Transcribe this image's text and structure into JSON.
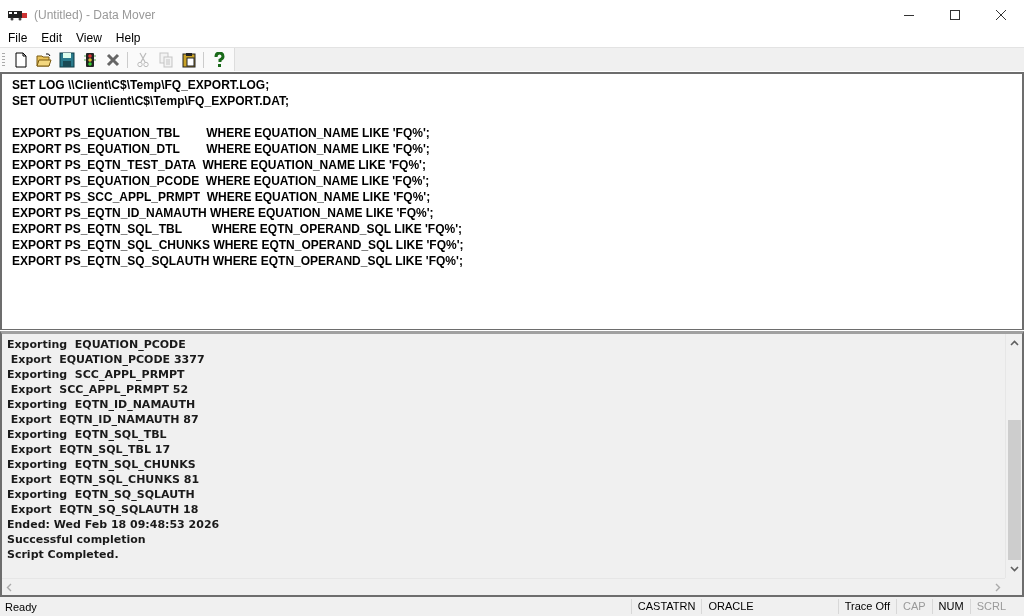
{
  "window": {
    "title": "(Untitled) - Data Mover"
  },
  "menu": [
    "File",
    "Edit",
    "View",
    "Help"
  ],
  "toolbar": [
    {
      "kind": "new",
      "disabled": false
    },
    {
      "kind": "open",
      "disabled": false
    },
    {
      "kind": "save",
      "disabled": false
    },
    {
      "kind": "run",
      "disabled": false
    },
    {
      "kind": "delete",
      "disabled": false
    },
    {
      "kind": "cut",
      "disabled": true
    },
    {
      "kind": "copy",
      "disabled": true
    },
    {
      "kind": "paste",
      "disabled": false
    },
    {
      "kind": "help",
      "disabled": false
    }
  ],
  "script_blocks": [
    [
      "SET LOG \\\\Client\\C$\\Temp\\FQ_EXPORT.LOG;",
      "SET OUTPUT \\\\Client\\C$\\Temp\\FQ_EXPORT.DAT;"
    ],
    [
      "EXPORT PS_EQUATION_TBL        WHERE EQUATION_NAME LIKE 'FQ%';",
      "EXPORT PS_EQUATION_DTL        WHERE EQUATION_NAME LIKE 'FQ%';",
      "EXPORT PS_EQTN_TEST_DATA  WHERE EQUATION_NAME LIKE 'FQ%';",
      "EXPORT PS_EQUATION_PCODE  WHERE EQUATION_NAME LIKE 'FQ%';",
      "EXPORT PS_SCC_APPL_PRMPT  WHERE EQUATION_NAME LIKE 'FQ%';",
      "EXPORT PS_EQTN_ID_NAMAUTH WHERE EQUATION_NAME LIKE 'FQ%';",
      "EXPORT PS_EQTN_SQL_TBL         WHERE EQTN_OPERAND_SQL LIKE 'FQ%';",
      "EXPORT PS_EQTN_SQL_CHUNKS WHERE EQTN_OPERAND_SQL LIKE 'FQ%';",
      "EXPORT PS_EQTN_SQ_SQLAUTH WHERE EQTN_OPERAND_SQL LIKE 'FQ%';"
    ]
  ],
  "log_lines": [
    "Exporting  EQUATION_PCODE",
    " Export  EQUATION_PCODE 3377",
    "Exporting  SCC_APPL_PRMPT",
    " Export  SCC_APPL_PRMPT 52",
    "Exporting  EQTN_ID_NAMAUTH",
    " Export  EQTN_ID_NAMAUTH 87",
    "Exporting  EQTN_SQL_TBL",
    " Export  EQTN_SQL_TBL 17",
    "Exporting  EQTN_SQL_CHUNKS",
    " Export  EQTN_SQL_CHUNKS 81",
    "Exporting  EQTN_SQ_SQLAUTH",
    " Export  EQTN_SQ_SQLAUTH 18",
    "Ended: Wed Feb 18 09:48:53 2026",
    "Successful completion",
    "Script Completed."
  ],
  "status_bar": {
    "message": "Ready",
    "panes": [
      "CASTATRN",
      "ORACLE",
      "Trace Off"
    ],
    "indicators": [
      {
        "text": "CAP",
        "on": false
      },
      {
        "text": "NUM",
        "on": true
      },
      {
        "text": "SCRL",
        "on": false
      }
    ]
  }
}
